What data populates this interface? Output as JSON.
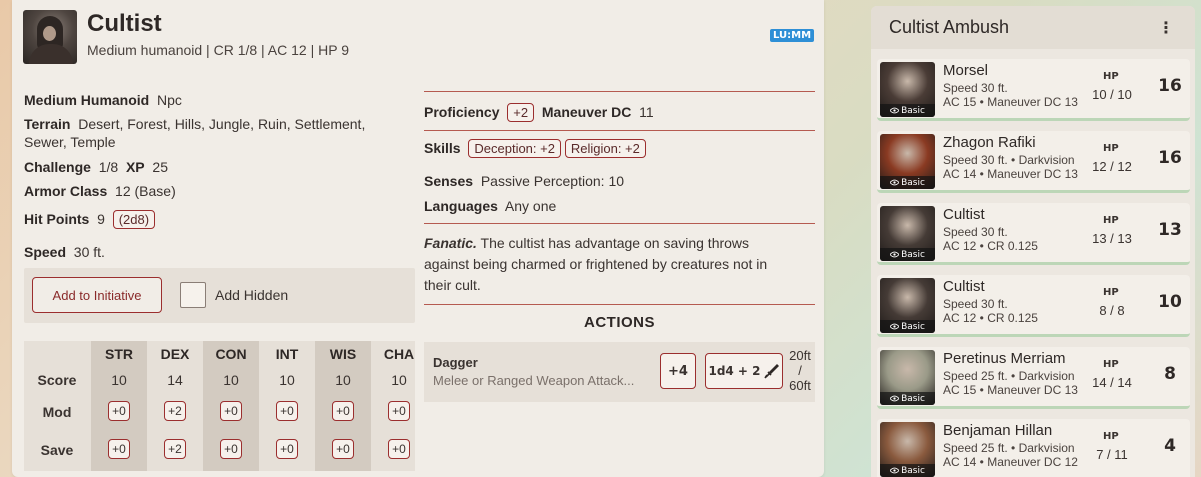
{
  "statblock": {
    "name": "Cultist",
    "subtitle": "Medium humanoid | CR 1/8 | AC 12 | HP 9",
    "source_badge": "LU:MM",
    "type_label": "Medium Humanoid",
    "type_value": "Npc",
    "terrain_label": "Terrain",
    "terrain_value_1": "Desert, Forest, Hills, Jungle, Ruin, Settlement,",
    "terrain_value_2": "Sewer, Temple",
    "challenge_label": "Challenge",
    "challenge_value": "1/8",
    "xp_label": "XP",
    "xp_value": "25",
    "ac_label": "Armor Class",
    "ac_value": "12 (Base)",
    "hp_label": "Hit Points",
    "hp_value": "9",
    "hp_dice": "(2d8)",
    "speed_label": "Speed",
    "speed_value": "30 ft.",
    "add_initiative": "Add to Initiative",
    "add_hidden": "Add Hidden",
    "proficiency_label": "Proficiency",
    "proficiency_value": "+2",
    "maneuver_label": "Maneuver DC",
    "maneuver_value": "11",
    "skills_label": "Skills",
    "skills": [
      "Deception: +2",
      "Religion: +2"
    ],
    "senses_label": "Senses",
    "senses_value": "Passive Perception: 10",
    "languages_label": "Languages",
    "languages_value": "Any one",
    "trait_name": "Fanatic.",
    "trait_text": "The cultist has advantage on saving throws against being charmed or frightened by creatures not in their cult.",
    "actions_title": "ACTIONS",
    "action": {
      "name": "Dagger",
      "desc": "Melee or Ranged Weapon Attack...",
      "to_hit": "+4",
      "damage": "1d4 + 2",
      "range_1": "20ft",
      "range_sep": "/",
      "range_2": "60ft"
    },
    "abilities": {
      "headers": [
        "STR",
        "DEX",
        "CON",
        "INT",
        "WIS",
        "CHA"
      ],
      "row_labels": [
        "Score",
        "Mod",
        "Save"
      ],
      "score": [
        "10",
        "14",
        "10",
        "10",
        "10",
        "10"
      ],
      "mod": [
        "+0",
        "+2",
        "+0",
        "+0",
        "+0",
        "+0"
      ],
      "save": [
        "+0",
        "+2",
        "+0",
        "+0",
        "+0",
        "+0"
      ]
    }
  },
  "encounter": {
    "title": "Cultist Ambush",
    "menu_icon": "kebab-menu-icon",
    "hp_label": "HP",
    "tag": "Basic",
    "combatants": [
      {
        "name": "Morsel",
        "line1": "Speed 30 ft.",
        "line2": "AC 15 • Maneuver DC 13",
        "hp": "10 / 10",
        "init": "16",
        "avatar": "#4a3c36"
      },
      {
        "name": "Zhagon Rafiki",
        "line1": "Speed 30 ft. • Darkvision",
        "line2": "AC 14 • Maneuver DC 13",
        "hp": "12 / 12",
        "init": "16",
        "avatar": "#8a3a22"
      },
      {
        "name": "Cultist",
        "line1": "Speed 30 ft.",
        "line2": "AC 12 • CR 0.125",
        "hp": "13 / 13",
        "init": "13",
        "avatar": "#453b36"
      },
      {
        "name": "Cultist",
        "line1": "Speed 30 ft.",
        "line2": "AC 12 • CR 0.125",
        "hp": "8 / 8",
        "init": "10",
        "avatar": "#453b36"
      },
      {
        "name": "Peretinus Merriam",
        "line1": "Speed 25 ft. • Darkvision",
        "line2": "AC 15 • Maneuver DC 13",
        "hp": "14 / 14",
        "init": "8",
        "avatar": "#9a9a88"
      },
      {
        "name": "Benjaman Hillan",
        "line1": "Speed 25 ft. • Darkvision",
        "line2": "AC 14 • Maneuver DC 12",
        "hp": "7 / 11",
        "init": "4",
        "avatar": "#8a5a3e"
      }
    ]
  }
}
